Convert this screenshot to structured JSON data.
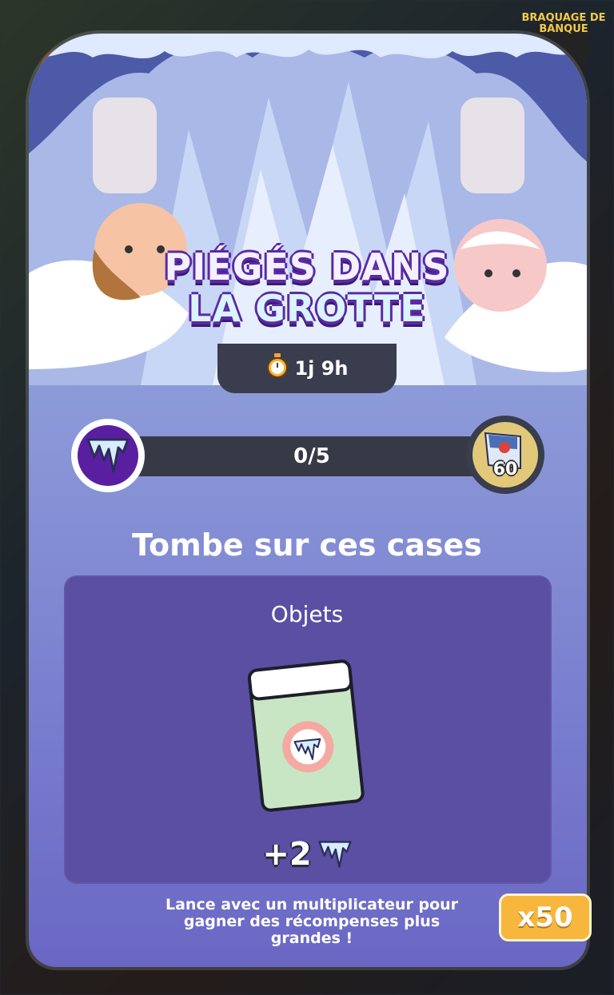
{
  "background": {
    "badge_label": "BRAQUAGE DE BANQUE"
  },
  "event": {
    "title_line1": "PIÉGÉS DANS",
    "title_line2": "LA GROTTE",
    "timer": "1j 9h"
  },
  "progress": {
    "current": 0,
    "target": 5,
    "label": "0/5",
    "reward_count": "60"
  },
  "objective": {
    "heading": "Tombe sur ces cases",
    "category": "Objets",
    "bonus": "+2"
  },
  "footer": {
    "hint": "Lance avec un multiplicateur pour gagner des récompenses plus grandes !",
    "multiplier_button": "x50"
  },
  "icons": {
    "timer": "stopwatch-icon",
    "token": "icicle-icon",
    "reward": "rebel-flag-icon",
    "tile": "item-card-icon"
  },
  "colors": {
    "accent_purple": "#5a1fa0",
    "card_bg": "#8f9dda",
    "button_gold": "#f6b73c"
  }
}
